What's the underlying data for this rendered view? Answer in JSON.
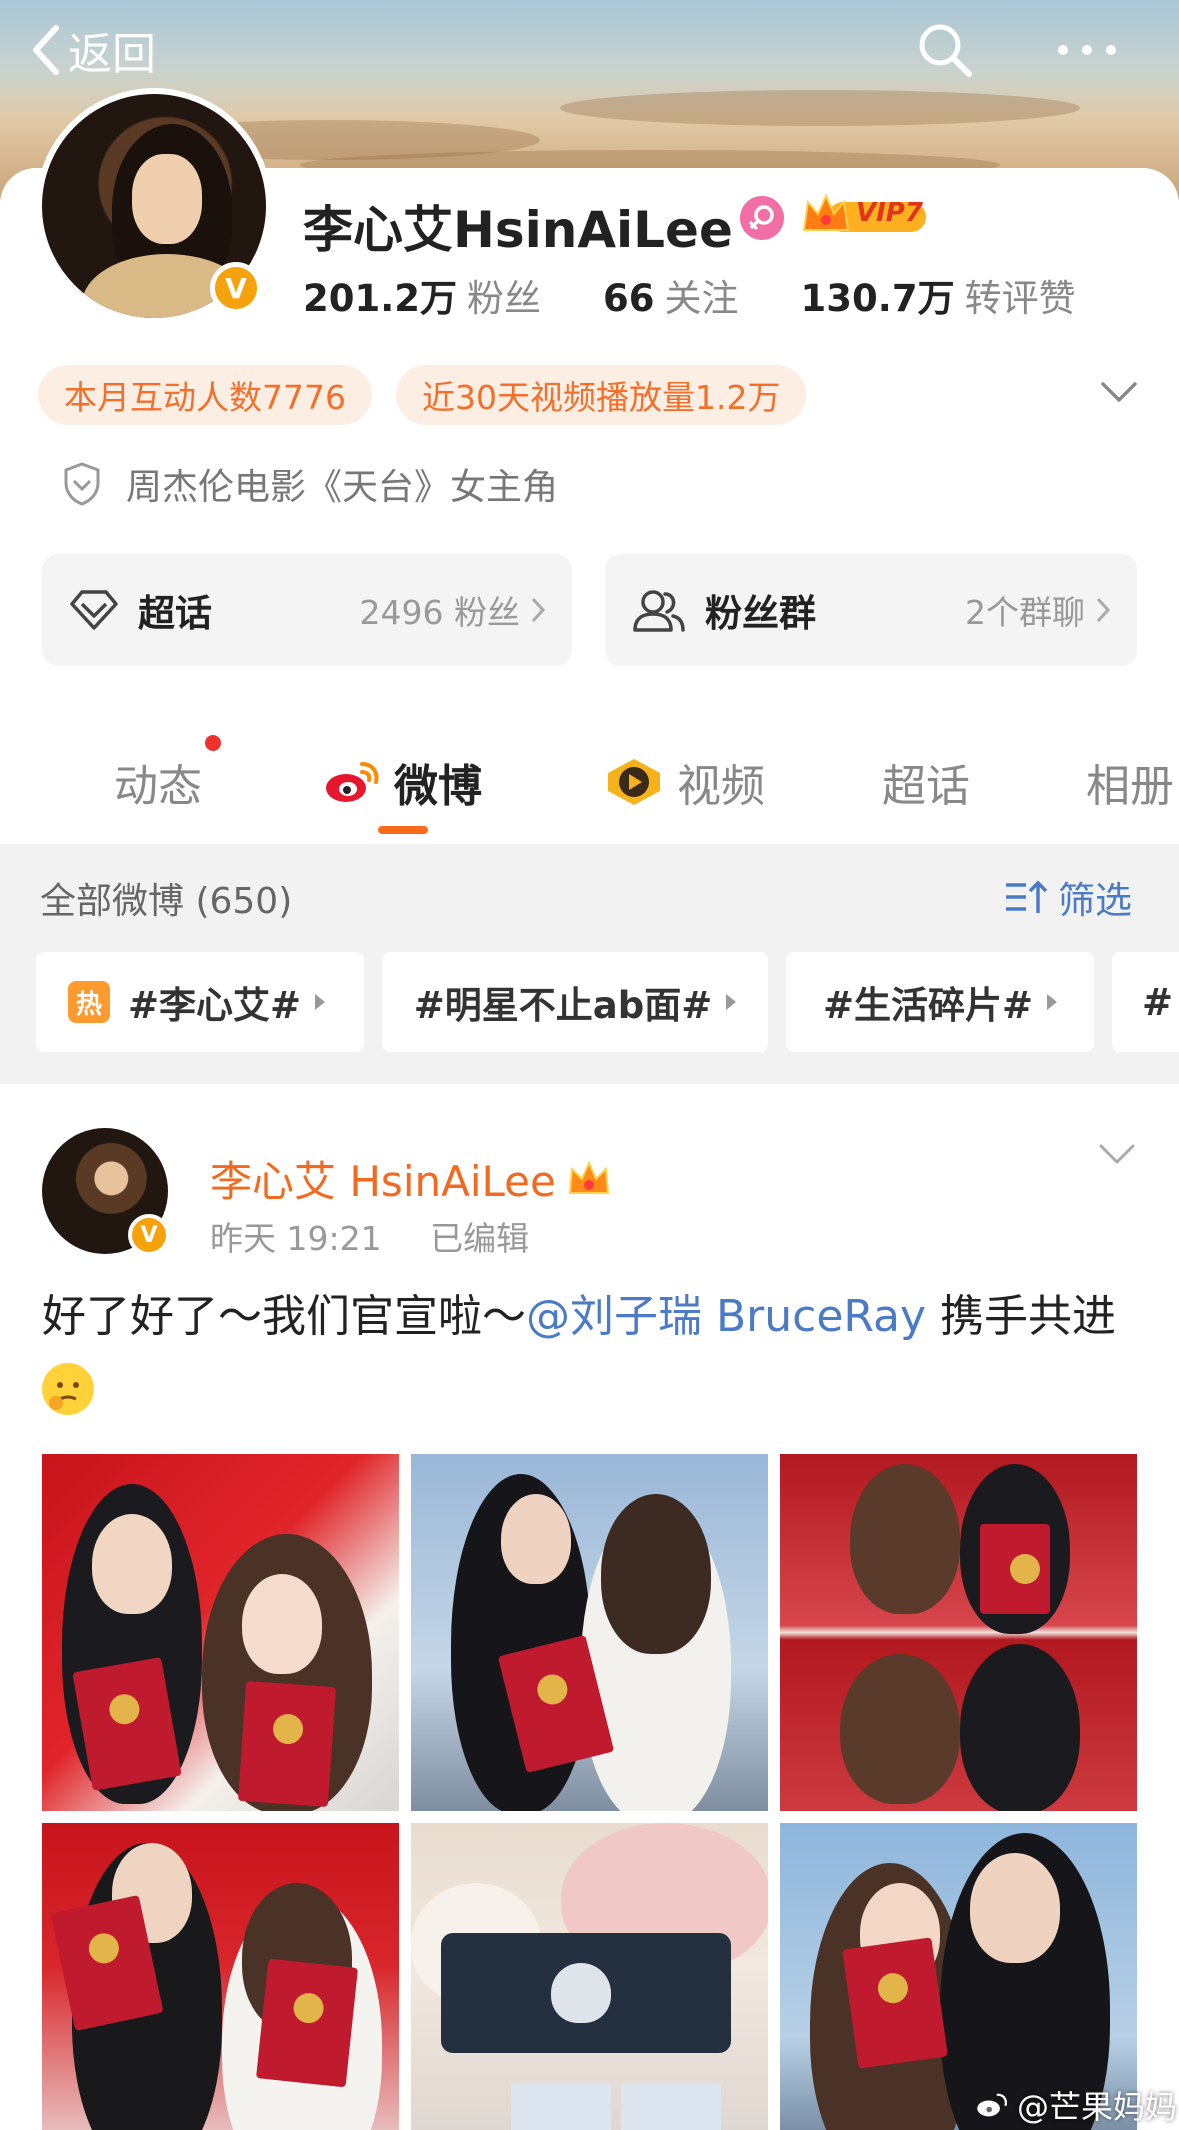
{
  "topbar": {
    "back_label": "返回"
  },
  "profile": {
    "name": "李心艾HsinAiLee",
    "vip_label": "VIP7",
    "verify_mark": "V",
    "stats": [
      {
        "num": "201.2万",
        "label": "粉丝"
      },
      {
        "num": "66",
        "label": "关注"
      },
      {
        "num": "130.7万",
        "label": "转评赞"
      }
    ],
    "chips": [
      "本月互动人数7776",
      "近30天视频播放量1.2万"
    ],
    "verification": "周杰伦电影《天台》女主角"
  },
  "boxes": {
    "supertopic": {
      "title": "超话",
      "right": "2496 粉丝"
    },
    "fangroup": {
      "title": "粉丝群",
      "right": "2个群聊"
    }
  },
  "tabs": [
    {
      "label": "动态",
      "active": false
    },
    {
      "label": "微博",
      "active": true
    },
    {
      "label": "视频",
      "active": false
    },
    {
      "label": "超话",
      "active": false
    },
    {
      "label": "相册",
      "active": false
    }
  ],
  "filter": {
    "all_label": "全部微博 (650)",
    "select_label": "筛选",
    "hot_badge": "热",
    "tags": [
      "#李心艾#",
      "#明星不止ab面#",
      "#生活碎片#",
      "#"
    ]
  },
  "post": {
    "author": "李心艾 HsinAiLee",
    "verify_mark": "V",
    "time": "昨天 19:21",
    "edited": "已编辑",
    "text_before": "好了好了～我们官宣啦～",
    "mention": "@刘子瑞 BruceRay",
    "text_after": " 携手共进"
  },
  "watermark": "@芒果妈妈",
  "colors": {
    "accent": "#ff6a1a",
    "link": "#4a7bc4",
    "chip_text": "#f36f2a",
    "vip_gold": "#f6a20c"
  }
}
